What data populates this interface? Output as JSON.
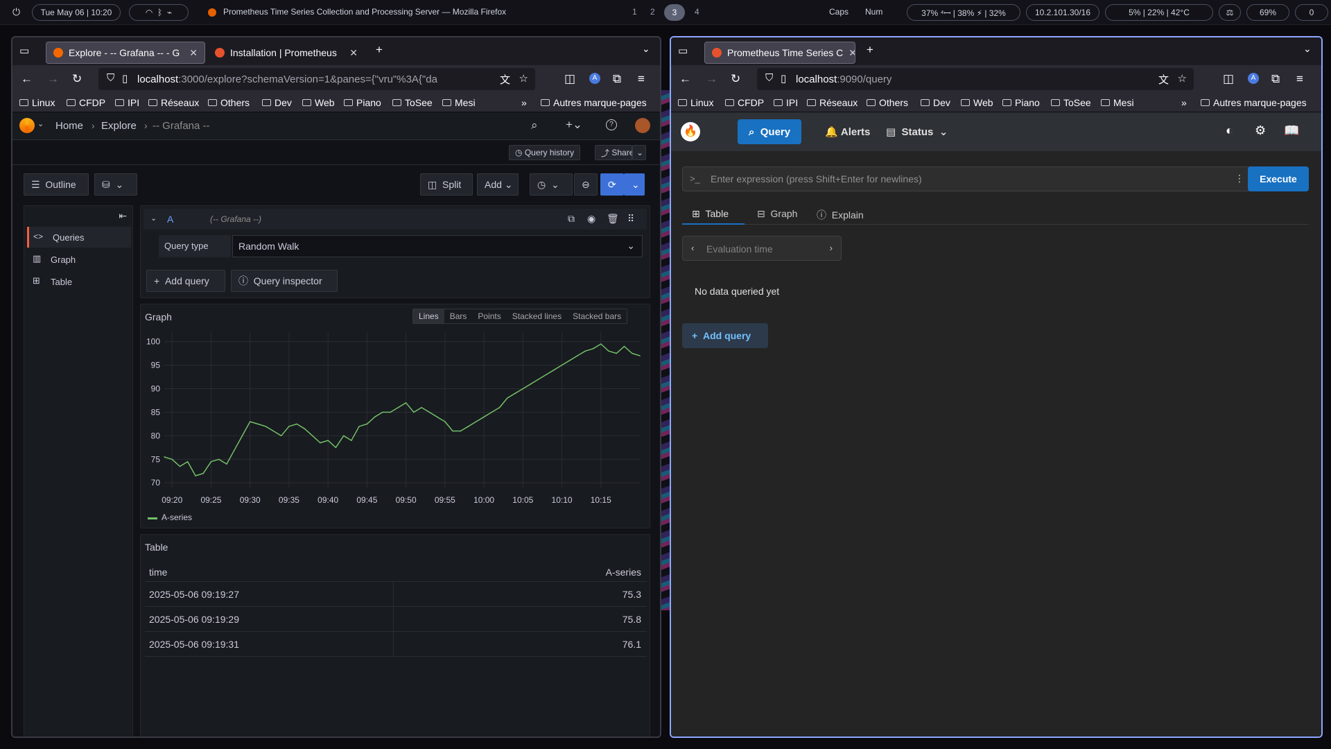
{
  "topbar": {
    "datetime": "Tue May 06 | 10:20",
    "window_title": "Prometheus Time Series Collection and Processing Server — Mozilla Firefox",
    "workspaces": [
      "1",
      "2",
      "3",
      "4"
    ],
    "active_workspace": "3",
    "caps": "Caps",
    "num": "Num",
    "cpu_stats": "37% ⁴ꟷ | 38% ⚡ | 32%",
    "ip": "10.2.101.30/16",
    "sys_stats": "5% | 22% | 42°C",
    "volume": "69%",
    "notif": "0"
  },
  "left_window": {
    "tabs": [
      {
        "label": "Explore - -- Grafana -- - G",
        "active": true
      },
      {
        "label": "Installation | Prometheus",
        "active": false
      }
    ],
    "url_host": "localhost",
    "url_rest": ":3000/explore?schemaVersion=1&panes={\"vru\"%3A{\"da",
    "bookmarks": [
      "Linux",
      "CFDP",
      "IPI",
      "Réseaux",
      "Others",
      "Dev",
      "Web",
      "Piano",
      "ToSee",
      "Mesi"
    ],
    "other_bookmarks": "Autres marque-pages"
  },
  "right_window": {
    "tabs": [
      {
        "label": "Prometheus Time Series C",
        "active": true
      }
    ],
    "url_host": "localhost",
    "url_rest": ":9090/query",
    "bookmarks": [
      "Linux",
      "CFDP",
      "IPI",
      "Réseaux",
      "Others",
      "Dev",
      "Web",
      "Piano",
      "ToSee",
      "Mesi"
    ],
    "other_bookmarks": "Autres marque-pages"
  },
  "grafana": {
    "breadcrumb": [
      "Home",
      "Explore",
      "-- Grafana --"
    ],
    "query_history": "Query history",
    "share": "Share",
    "outline": "Outline",
    "split": "Split",
    "add": "Add",
    "outline_items": [
      "Queries",
      "Graph",
      "Table"
    ],
    "query": {
      "ref": "A",
      "datasource": "(-- Grafana --)",
      "type_label": "Query type",
      "type_value": "Random Walk"
    },
    "add_query": "Add query",
    "query_inspector": "Query inspector",
    "graph_title": "Graph",
    "graph_modes": [
      "Lines",
      "Bars",
      "Points",
      "Stacked lines",
      "Stacked bars"
    ],
    "graph_mode_active": "Lines",
    "legend": "A-series",
    "table_title": "Table",
    "table_headers": [
      "time",
      "A-series"
    ],
    "table_rows": [
      [
        "2025-05-06 09:19:27",
        "75.3"
      ],
      [
        "2025-05-06 09:19:29",
        "75.8"
      ],
      [
        "2025-05-06 09:19:31",
        "76.1"
      ]
    ]
  },
  "chart_data": {
    "type": "line",
    "title": "Graph",
    "xlabel": "",
    "ylabel": "",
    "ylim": [
      69,
      102
    ],
    "y_ticks": [
      70,
      75,
      80,
      85,
      90,
      95,
      100
    ],
    "x_ticks": [
      "09:20",
      "09:25",
      "09:30",
      "09:35",
      "09:40",
      "09:45",
      "09:50",
      "09:55",
      "10:00",
      "10:05",
      "10:10",
      "10:15"
    ],
    "x": [
      "09:19",
      "09:20",
      "09:21",
      "09:22",
      "09:23",
      "09:24",
      "09:25",
      "09:26",
      "09:27",
      "09:28",
      "09:29",
      "09:30",
      "09:31",
      "09:32",
      "09:33",
      "09:34",
      "09:35",
      "09:36",
      "09:37",
      "09:38",
      "09:39",
      "09:40",
      "09:41",
      "09:42",
      "09:43",
      "09:44",
      "09:45",
      "09:46",
      "09:47",
      "09:48",
      "09:49",
      "09:50",
      "09:51",
      "09:52",
      "09:53",
      "09:54",
      "09:55",
      "09:56",
      "09:57",
      "09:58",
      "09:59",
      "10:00",
      "10:01",
      "10:02",
      "10:03",
      "10:04",
      "10:05",
      "10:06",
      "10:07",
      "10:08",
      "10:09",
      "10:10",
      "10:11",
      "10:12",
      "10:13",
      "10:14",
      "10:15",
      "10:16",
      "10:17",
      "10:18",
      "10:19",
      "10:20"
    ],
    "series": [
      {
        "name": "A-series",
        "color": "#73bf69",
        "values": [
          75.5,
          75,
          73.5,
          74.5,
          71.5,
          72,
          74.5,
          75,
          74,
          77,
          80,
          83,
          82.5,
          82,
          81,
          80,
          82,
          82.5,
          81.5,
          80,
          78.5,
          79,
          77.5,
          80,
          79,
          82,
          82.5,
          84,
          85,
          85,
          86,
          87,
          85,
          86,
          85,
          84,
          83,
          81,
          81,
          82,
          83,
          84,
          85,
          86,
          88,
          89,
          90,
          91,
          92,
          93,
          94,
          95,
          96,
          97,
          98,
          98.5,
          99.5,
          98,
          97.5,
          99,
          97.5,
          97
        ]
      }
    ]
  },
  "prometheus": {
    "nav": [
      "Query",
      "Alerts",
      "Status"
    ],
    "expression_placeholder": "Enter expression (press Shift+Enter for newlines)",
    "execute": "Execute",
    "tabs": [
      "Table",
      "Graph",
      "Explain"
    ],
    "evaluation_time": "Evaluation time",
    "no_data": "No data queried yet",
    "add_query": "Add query"
  }
}
